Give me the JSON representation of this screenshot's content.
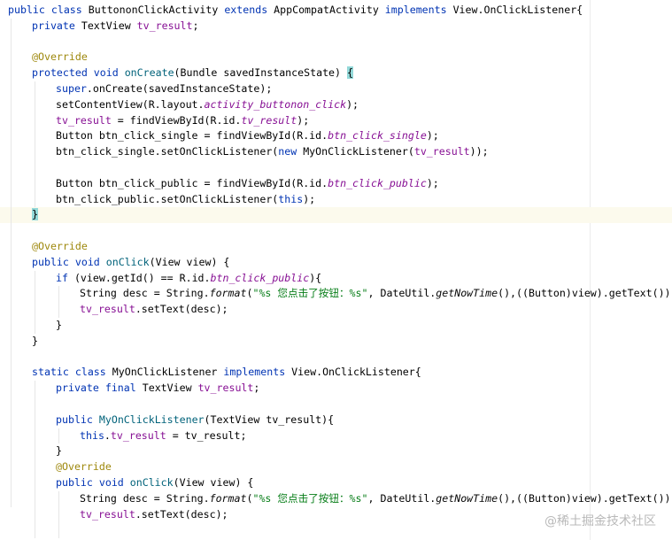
{
  "editor": {
    "lines": [
      {
        "indent": 0,
        "tokens": [
          {
            "t": "public class ",
            "c": "kw"
          },
          {
            "t": "ButtononClickActivity ",
            "c": "cn"
          },
          {
            "t": "extends ",
            "c": "kw"
          },
          {
            "t": "AppCompatActivity ",
            "c": "cn"
          },
          {
            "t": "implements ",
            "c": "kw"
          },
          {
            "t": "View.OnClickListener{",
            "c": "cn"
          }
        ]
      },
      {
        "indent": 1,
        "tokens": [
          {
            "t": "private ",
            "c": "kw"
          },
          {
            "t": "TextView ",
            "c": "cn"
          },
          {
            "t": "tv_result",
            "c": "fld"
          },
          {
            "t": ";",
            "c": "cn"
          }
        ]
      },
      {
        "indent": 0,
        "tokens": []
      },
      {
        "indent": 1,
        "tokens": [
          {
            "t": "@Override",
            "c": "ann"
          }
        ]
      },
      {
        "indent": 1,
        "tokens": [
          {
            "t": "protected void ",
            "c": "kw"
          },
          {
            "t": "onCreate",
            "c": "mth"
          },
          {
            "t": "(Bundle savedInstanceState) ",
            "c": "cn"
          },
          {
            "t": "{",
            "c": "brace"
          }
        ]
      },
      {
        "indent": 2,
        "tokens": [
          {
            "t": "super",
            "c": "kw"
          },
          {
            "t": ".onCreate(savedInstanceState);",
            "c": "cn"
          }
        ]
      },
      {
        "indent": 2,
        "tokens": [
          {
            "t": "setContentView(R.layout.",
            "c": "cn"
          },
          {
            "t": "activity_buttonon_click",
            "c": "italfld"
          },
          {
            "t": ");",
            "c": "cn"
          }
        ]
      },
      {
        "indent": 2,
        "tokens": [
          {
            "t": "tv_result",
            "c": "fld"
          },
          {
            "t": " = findViewById(R.id.",
            "c": "cn"
          },
          {
            "t": "tv_result",
            "c": "italfld"
          },
          {
            "t": ");",
            "c": "cn"
          }
        ]
      },
      {
        "indent": 2,
        "tokens": [
          {
            "t": "Button btn_click_single = findViewById(R.id.",
            "c": "cn"
          },
          {
            "t": "btn_click_single",
            "c": "italfld"
          },
          {
            "t": ");",
            "c": "cn"
          }
        ]
      },
      {
        "indent": 2,
        "tokens": [
          {
            "t": "btn_click_single.setOnClickListener(",
            "c": "cn"
          },
          {
            "t": "new ",
            "c": "kw"
          },
          {
            "t": "MyOnClickListener(",
            "c": "cn"
          },
          {
            "t": "tv_result",
            "c": "fld"
          },
          {
            "t": "));",
            "c": "cn"
          }
        ]
      },
      {
        "indent": 0,
        "tokens": []
      },
      {
        "indent": 2,
        "tokens": [
          {
            "t": "Button btn_click_public = findViewById(R.id.",
            "c": "cn"
          },
          {
            "t": "btn_click_public",
            "c": "italfld"
          },
          {
            "t": ");",
            "c": "cn"
          }
        ]
      },
      {
        "indent": 2,
        "tokens": [
          {
            "t": "btn_click_public.setOnClickListener(",
            "c": "cn"
          },
          {
            "t": "this",
            "c": "kw"
          },
          {
            "t": ");",
            "c": "cn"
          }
        ]
      },
      {
        "indent": 1,
        "current": true,
        "tokens": [
          {
            "t": "}",
            "c": "brace"
          }
        ]
      },
      {
        "indent": 0,
        "tokens": []
      },
      {
        "indent": 1,
        "tokens": [
          {
            "t": "@Override",
            "c": "ann"
          }
        ]
      },
      {
        "indent": 1,
        "tokens": [
          {
            "t": "public void ",
            "c": "kw"
          },
          {
            "t": "onClick",
            "c": "mth"
          },
          {
            "t": "(View view) {",
            "c": "cn"
          }
        ]
      },
      {
        "indent": 2,
        "tokens": [
          {
            "t": "if ",
            "c": "kw"
          },
          {
            "t": "(view.getId() == R.id.",
            "c": "cn"
          },
          {
            "t": "btn_click_public",
            "c": "italfld"
          },
          {
            "t": "){",
            "c": "cn"
          }
        ]
      },
      {
        "indent": 3,
        "tokens": [
          {
            "t": "String desc = String.",
            "c": "cn"
          },
          {
            "t": "format",
            "c": "ital"
          },
          {
            "t": "(",
            "c": "cn"
          },
          {
            "t": "\"%s 您点击了按钮：%s\"",
            "c": "str"
          },
          {
            "t": ", DateUtil.",
            "c": "cn"
          },
          {
            "t": "getNowTime",
            "c": "ital"
          },
          {
            "t": "(),((Button)view).getText());",
            "c": "cn"
          }
        ]
      },
      {
        "indent": 3,
        "tokens": [
          {
            "t": "tv_result",
            "c": "fld"
          },
          {
            "t": ".setText(desc);",
            "c": "cn"
          }
        ]
      },
      {
        "indent": 2,
        "tokens": [
          {
            "t": "}",
            "c": "cn"
          }
        ]
      },
      {
        "indent": 1,
        "tokens": [
          {
            "t": "}",
            "c": "cn"
          }
        ]
      },
      {
        "indent": 0,
        "tokens": []
      },
      {
        "indent": 1,
        "tokens": [
          {
            "t": "static class ",
            "c": "kw"
          },
          {
            "t": "MyOnClickListener ",
            "c": "cn"
          },
          {
            "t": "implements ",
            "c": "kw"
          },
          {
            "t": "View.OnClickListener{",
            "c": "cn"
          }
        ]
      },
      {
        "indent": 2,
        "tokens": [
          {
            "t": "private final ",
            "c": "kw"
          },
          {
            "t": "TextView ",
            "c": "cn"
          },
          {
            "t": "tv_result",
            "c": "fld"
          },
          {
            "t": ";",
            "c": "cn"
          }
        ]
      },
      {
        "indent": 0,
        "tokens": []
      },
      {
        "indent": 2,
        "tokens": [
          {
            "t": "public ",
            "c": "kw"
          },
          {
            "t": "MyOnClickListener",
            "c": "mth"
          },
          {
            "t": "(TextView tv_result){",
            "c": "cn"
          }
        ]
      },
      {
        "indent": 3,
        "tokens": [
          {
            "t": "this",
            "c": "kw"
          },
          {
            "t": ".",
            "c": "cn"
          },
          {
            "t": "tv_result",
            "c": "fld"
          },
          {
            "t": " = tv_result;",
            "c": "cn"
          }
        ]
      },
      {
        "indent": 2,
        "tokens": [
          {
            "t": "}",
            "c": "cn"
          }
        ]
      },
      {
        "indent": 2,
        "tokens": [
          {
            "t": "@Override",
            "c": "ann"
          }
        ]
      },
      {
        "indent": 2,
        "tokens": [
          {
            "t": "public void ",
            "c": "kw"
          },
          {
            "t": "onClick",
            "c": "mth"
          },
          {
            "t": "(View view) {",
            "c": "cn"
          }
        ]
      },
      {
        "indent": 3,
        "tokens": [
          {
            "t": "String desc = String.",
            "c": "cn"
          },
          {
            "t": "format",
            "c": "ital"
          },
          {
            "t": "(",
            "c": "cn"
          },
          {
            "t": "\"%s 您点击了按钮：%s\"",
            "c": "str"
          },
          {
            "t": ", DateUtil.",
            "c": "cn"
          },
          {
            "t": "getNowTime",
            "c": "ital"
          },
          {
            "t": "(),((Button)view).getText());",
            "c": "cn"
          }
        ]
      },
      {
        "indent": 3,
        "tokens": [
          {
            "t": "tv_result",
            "c": "fld"
          },
          {
            "t": ".setText(desc);",
            "c": "cn"
          }
        ]
      }
    ]
  },
  "watermark": "@稀土掘金技术社区"
}
